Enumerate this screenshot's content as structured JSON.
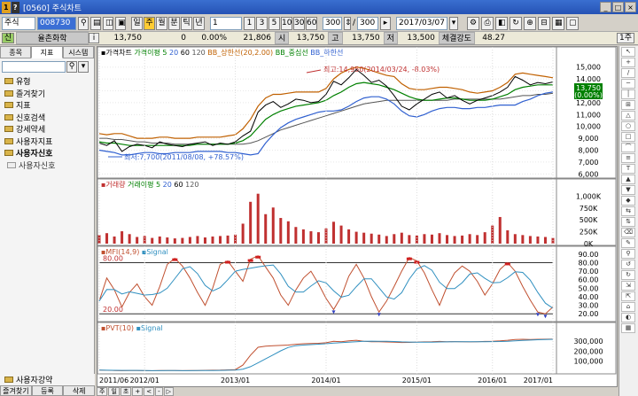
{
  "window": {
    "title": "[0560] 주식차트",
    "logo_left": "1",
    "logo_right": "?"
  },
  "toolbar": {
    "market": "주식",
    "code": "008730",
    "periods": [
      "일",
      "주",
      "월",
      "분",
      "틱",
      "년"
    ],
    "selected_period": "주",
    "interval_value": "1",
    "intervals": [
      "1",
      "3",
      "5",
      "10",
      "30",
      "60"
    ],
    "count_value": "300",
    "count_total": "300",
    "date": "2017/03/07",
    "right_label": "1주"
  },
  "quote": {
    "name": "율촌화학",
    "price": "13,750",
    "change": "0",
    "rate": "0.00%",
    "volume": "21,806",
    "open_label": "시",
    "open": "13,750",
    "high_label": "고",
    "high": "13,750",
    "low_label": "저",
    "low": "13,500",
    "strength_label": "체결강도",
    "strength": "48.27"
  },
  "sidebar": {
    "tabs": [
      "종목",
      "지표",
      "시스템"
    ],
    "active_tab": "지표",
    "items": [
      {
        "label": "유형",
        "bold": false
      },
      {
        "label": "즐겨찾기",
        "bold": false
      },
      {
        "label": "지표",
        "bold": false
      },
      {
        "label": "신호검색",
        "bold": false
      },
      {
        "label": "강세약세",
        "bold": false
      },
      {
        "label": "사용자지표",
        "bold": false
      },
      {
        "label": "사용자신호",
        "bold": true
      }
    ],
    "sub_item": "사용자신호",
    "bottom_item": "사용자강약",
    "bottom_tabs": [
      "즐겨찾기",
      "등록",
      "삭제"
    ]
  },
  "chart_data": [
    {
      "type": "line",
      "title": "가격차트",
      "legend": [
        "가격이평 5",
        "20",
        "60",
        "120",
        "BB_상한선(20,2.00)",
        "BB_중심선",
        "BB_하한선"
      ],
      "annotations": [
        "최고:14,950(2014/03/24, -8.03%)",
        "최저:7,700(2011/08/08, +78.57%)"
      ],
      "current_price_label": "13,750",
      "current_rate_label": "(0.00%)",
      "yticks": [
        15000,
        14000,
        13000,
        12000,
        11000,
        10000,
        9000,
        8000,
        7000,
        6000
      ],
      "ytick_labels": [
        "15,000",
        "14,000",
        "13,000",
        "12,000",
        "11,000",
        "10,000",
        "9,000",
        "8,000",
        "7,000",
        "6,000"
      ],
      "ylim": [
        5800,
        15800
      ],
      "x": [
        0,
        1,
        2,
        3,
        4,
        5,
        6,
        7,
        8,
        9,
        10,
        11,
        12,
        13,
        14,
        15,
        16,
        17,
        18,
        19,
        20,
        21,
        22,
        23,
        24,
        25,
        26,
        27,
        28,
        29,
        30,
        31,
        32,
        33,
        34,
        35,
        36,
        37,
        38,
        39,
        40,
        41,
        42,
        43,
        44,
        45,
        46,
        47,
        48,
        49,
        50,
        51,
        52,
        53,
        54,
        55,
        56,
        57,
        58,
        59,
        60
      ],
      "price": [
        8600,
        8400,
        8800,
        7900,
        8300,
        8500,
        8400,
        8200,
        8700,
        8500,
        8400,
        8300,
        8500,
        8600,
        8700,
        8400,
        8600,
        8500,
        8700,
        9200,
        9600,
        11200,
        11800,
        12100,
        11600,
        11900,
        12300,
        12200,
        12000,
        12100,
        12700,
        13800,
        13500,
        14100,
        14800,
        14300,
        13700,
        13900,
        13400,
        12600,
        11700,
        11400,
        11900,
        12300,
        12700,
        12900,
        12400,
        12600,
        12200,
        11900,
        12200,
        12400,
        12600,
        12900,
        13300,
        14200,
        13900,
        13500,
        13700,
        13600,
        13750
      ],
      "bb_upper": [
        9400,
        9300,
        9400,
        9400,
        9200,
        9000,
        9000,
        9000,
        9100,
        9100,
        9000,
        9000,
        9000,
        9100,
        9100,
        9100,
        9100,
        9200,
        9300,
        9800,
        10600,
        11700,
        12400,
        12700,
        12700,
        12800,
        12900,
        12900,
        12900,
        12900,
        13200,
        14000,
        14500,
        14800,
        15000,
        14900,
        14700,
        14500,
        14300,
        14200,
        13600,
        13200,
        13100,
        13100,
        13200,
        13300,
        13300,
        13200,
        13100,
        12900,
        12800,
        12900,
        13000,
        13300,
        13700,
        14400,
        14500,
        14400,
        14300,
        14200,
        14100
      ],
      "bb_mid": [
        8700,
        8600,
        8600,
        8500,
        8400,
        8400,
        8400,
        8400,
        8400,
        8400,
        8400,
        8400,
        8400,
        8500,
        8500,
        8500,
        8500,
        8500,
        8600,
        8800,
        9200,
        9900,
        10600,
        11000,
        11300,
        11500,
        11700,
        11800,
        11900,
        12000,
        12200,
        12600,
        12900,
        13300,
        13600,
        13700,
        13600,
        13500,
        13300,
        13100,
        12800,
        12500,
        12300,
        12200,
        12200,
        12300,
        12400,
        12400,
        12300,
        12200,
        12200,
        12200,
        12300,
        12500,
        12700,
        13100,
        13300,
        13400,
        13500,
        13500,
        13500
      ],
      "bb_lower": [
        8000,
        7900,
        7800,
        7600,
        7600,
        7700,
        7800,
        7800,
        7700,
        7700,
        7800,
        7800,
        7800,
        7900,
        7900,
        7900,
        7900,
        7800,
        7800,
        7700,
        7600,
        7700,
        8600,
        9300,
        9900,
        10300,
        10600,
        10800,
        11000,
        11200,
        11300,
        11300,
        11400,
        11700,
        12100,
        12400,
        12500,
        12500,
        12300,
        11900,
        11300,
        10900,
        10800,
        11000,
        11300,
        11500,
        11600,
        11600,
        11500,
        11500,
        11600,
        11600,
        11700,
        11800,
        11800,
        11800,
        12100,
        12300,
        12600,
        12800,
        12900
      ],
      "ma120": [
        9000,
        9000,
        8900,
        8900,
        8800,
        8700,
        8700,
        8600,
        8600,
        8600,
        8500,
        8500,
        8500,
        8500,
        8500,
        8500,
        8500,
        8500,
        8500,
        8500,
        8600,
        8800,
        9100,
        9400,
        9700,
        9900,
        10100,
        10300,
        10500,
        10700,
        10900,
        11100,
        11300,
        11500,
        11700,
        11900,
        12000,
        12100,
        12200,
        12200,
        12200,
        12200,
        12200,
        12200,
        12200,
        12200,
        12200,
        12300,
        12300,
        12300,
        12300,
        12300,
        12300,
        12300,
        12400,
        12500,
        12600,
        12600,
        12700,
        12700,
        12800
      ]
    },
    {
      "type": "bar",
      "title": "거래량",
      "legend": [
        "거래이평 5",
        "20",
        "60",
        "120"
      ],
      "ytick_labels": [
        "1,000K",
        "750K",
        "500K",
        "250K",
        "0K"
      ],
      "ylim": [
        0,
        1100000
      ],
      "values": [
        180000,
        220000,
        150000,
        260000,
        200000,
        140000,
        160000,
        120000,
        150000,
        130000,
        110000,
        120000,
        140000,
        160000,
        130000,
        150000,
        160000,
        170000,
        190000,
        420000,
        880000,
        1050000,
        620000,
        760000,
        540000,
        470000,
        350000,
        300000,
        260000,
        240000,
        320000,
        460000,
        380000,
        300000,
        250000,
        230000,
        210000,
        190000,
        160000,
        200000,
        230000,
        180000,
        170000,
        200000,
        190000,
        220000,
        180000,
        160000,
        170000,
        200000,
        180000,
        240000,
        380000,
        560000,
        280000,
        200000,
        180000,
        160000,
        150000,
        140000,
        120000
      ]
    },
    {
      "type": "line",
      "title": "MFI(14,9)",
      "legend": [
        "MFI(14,9)",
        "Signal"
      ],
      "ytick_labels": [
        "90.00",
        "80.00",
        "70.00",
        "60.00",
        "50.00",
        "40.00",
        "30.00",
        "20.00"
      ],
      "level_labels": [
        "80.00",
        "20.00"
      ],
      "ylim": [
        15,
        95
      ],
      "values": [
        35,
        62,
        48,
        28,
        45,
        55,
        40,
        30,
        52,
        78,
        85,
        76,
        62,
        45,
        30,
        50,
        78,
        82,
        70,
        58,
        84,
        88,
        75,
        62,
        42,
        30,
        48,
        62,
        70,
        55,
        38,
        25,
        40,
        64,
        78,
        62,
        40,
        22,
        35,
        52,
        70,
        86,
        82,
        68,
        48,
        30,
        52,
        68,
        76,
        70,
        58,
        42,
        55,
        72,
        80,
        70,
        52,
        36,
        22,
        20,
        28
      ]
    },
    {
      "type": "line",
      "title": "PVT(10)",
      "legend": [
        "PVT(10)",
        "Signal"
      ],
      "ytick_labels": [
        "300,000",
        "200,000",
        "100,000"
      ],
      "ylim": [
        -10000,
        400000
      ],
      "values": [
        10000,
        8000,
        6000,
        4000,
        5000,
        6000,
        4000,
        3000,
        5000,
        6000,
        5000,
        4000,
        5000,
        6000,
        8000,
        9000,
        10000,
        12000,
        15000,
        60000,
        160000,
        240000,
        250000,
        255000,
        258000,
        262000,
        270000,
        275000,
        278000,
        280000,
        285000,
        300000,
        295000,
        305000,
        310000,
        300000,
        295000,
        296000,
        293000,
        290000,
        288000,
        289000,
        292000,
        294000,
        295000,
        298000,
        296000,
        297000,
        295000,
        294000,
        296000,
        298000,
        300000,
        304000,
        310000,
        318000,
        320000,
        318000,
        320000,
        321000,
        322000
      ]
    },
    {
      "type": "table",
      "xtick_labels": [
        "2011/06",
        "2012/01",
        "2013/01",
        "2014/01",
        "2015/01",
        "2016/01",
        "2017/01"
      ],
      "xtick_index": [
        0,
        6,
        18,
        30,
        42,
        52,
        60
      ]
    }
  ],
  "right_tools": [
    "↖",
    "+",
    "/",
    "─",
    "│",
    "⊞",
    "△",
    "○",
    "□",
    "⌒",
    "≡",
    "T",
    "▲",
    "▼",
    "◆",
    "⇆",
    "⇅",
    "⌫",
    "✎",
    "⚲",
    "↺",
    "↻",
    "⇲",
    "⇱",
    "⌂",
    "◐",
    "▦"
  ],
  "bottom_buttons": [
    "주",
    "일",
    "초",
    "+",
    "<",
    "-",
    "▷"
  ],
  "colors": {
    "price": "#000000",
    "bb_upper": "#c06000",
    "bb_mid": "#008000",
    "bb_lower": "#3060d0",
    "ma120": "#555555",
    "volume": "#c03030",
    "mfi": "#c05030",
    "signal": "#3090c0",
    "pvt": "#c05030",
    "title_bar": "#2b5cc0",
    "highlight": "#ffcc33"
  }
}
